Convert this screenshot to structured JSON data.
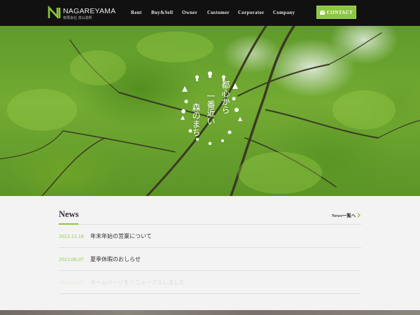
{
  "header": {
    "logo_text": "NAGAREYAMA",
    "logo_sub": "有限会社 流山造邦",
    "nav": [
      {
        "label": "Rent"
      },
      {
        "label": "Buy&Sell"
      },
      {
        "label": "Owner"
      },
      {
        "label": "Customer"
      },
      {
        "label": "Corporator"
      },
      {
        "label": "Company"
      }
    ],
    "contact_label": "CONTACT"
  },
  "hero": {
    "emblem_lines": [
      "都心から",
      "一番近い",
      "森のまち"
    ]
  },
  "news": {
    "title": "News",
    "all_link": "News一覧へ",
    "items": [
      {
        "date": "2023.12.18",
        "text": "年末年始の営業について"
      },
      {
        "date": "2023.08.07",
        "text": "夏季休暇のおしらせ"
      },
      {
        "date": "2023.04.10",
        "text": "ホームページをリニューアルしました"
      }
    ]
  },
  "colors": {
    "accent": "#8dc63f",
    "header_bg": "#111111",
    "page_bg": "#f3f3f3"
  }
}
